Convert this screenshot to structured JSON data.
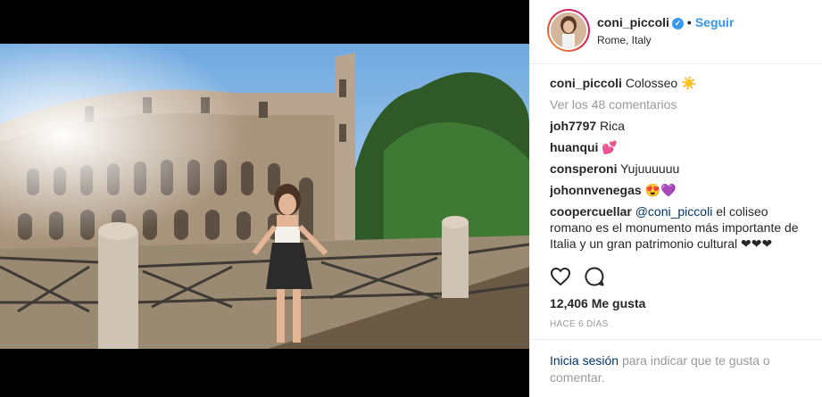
{
  "header": {
    "username": "coni_piccoli",
    "verified_icon": "verified-badge-icon",
    "dot": "•",
    "follow_label": "Seguir",
    "location": "Rome, Italy"
  },
  "caption": {
    "username": "coni_piccoli",
    "text": "Colosseo",
    "emoji": "☀️"
  },
  "view_more": "Ver los 48 comentarios",
  "comments": [
    {
      "username": "joh7797",
      "text": "Rica",
      "emoji": ""
    },
    {
      "username": "huanqui",
      "text": "",
      "emoji": "💕"
    },
    {
      "username": "consperoni",
      "text": "Yujuuuuuu",
      "emoji": ""
    },
    {
      "username": "johonnvenegas",
      "text": "",
      "emoji": "😍💜"
    },
    {
      "username": "coopercuellar",
      "mention": "@coni_piccoli",
      "text": "el coliseo romano es el monumento más importante de Italia y un gran patrimonio cultural",
      "emoji": "❤❤❤"
    }
  ],
  "actions": {
    "like_icon": "heart-icon",
    "comment_icon": "comment-icon"
  },
  "likes": "12,406 Me gusta",
  "time": "HACE 6 DÍAS",
  "footer": {
    "login_label": "Inicia sesión",
    "text": "para indicar que te gusta o comentar."
  },
  "colors": {
    "link_blue": "#3897f0",
    "dark_link": "#003569",
    "muted": "#999999",
    "text": "#262626"
  }
}
